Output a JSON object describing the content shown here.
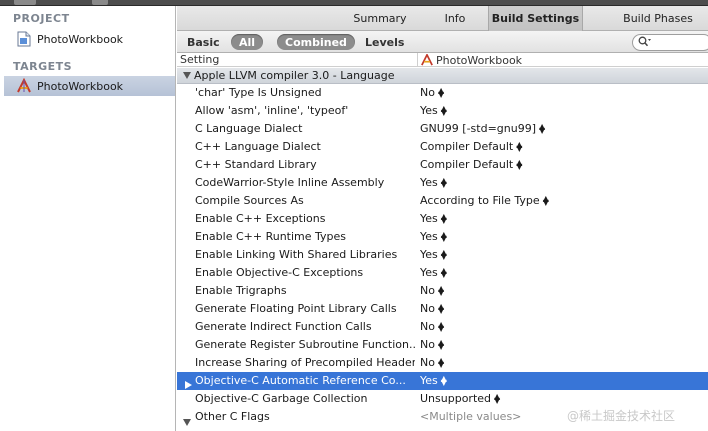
{
  "sidebar": {
    "project_header": "PROJECT",
    "project_item": "PhotoWorkbook",
    "targets_header": "TARGETS",
    "target_item": "PhotoWorkbook"
  },
  "tabs": [
    {
      "label": "Summary"
    },
    {
      "label": "Info"
    },
    {
      "label": "Build Settings"
    },
    {
      "label": "Build Phases"
    }
  ],
  "filter": {
    "basic": "Basic",
    "all": "All",
    "combined": "Combined",
    "levels": "Levels",
    "search_placeholder": ""
  },
  "columns": {
    "setting": "Setting",
    "target": "PhotoWorkbook"
  },
  "section": {
    "title": "Apple LLVM compiler 3.0 - Language"
  },
  "rows": [
    {
      "name": "'char' Type Is Unsigned",
      "value": "No"
    },
    {
      "name": "Allow 'asm', 'inline', 'typeof'",
      "value": "Yes"
    },
    {
      "name": "C Language Dialect",
      "value": "GNU99 [-std=gnu99]"
    },
    {
      "name": "C++ Language Dialect",
      "value": "Compiler Default"
    },
    {
      "name": "C++ Standard Library",
      "value": "Compiler Default"
    },
    {
      "name": "CodeWarrior-Style Inline Assembly",
      "value": "Yes"
    },
    {
      "name": "Compile Sources As",
      "value": "According to File Type"
    },
    {
      "name": "Enable C++ Exceptions",
      "value": "Yes"
    },
    {
      "name": "Enable C++ Runtime Types",
      "value": "Yes"
    },
    {
      "name": "Enable Linking With Shared Libraries",
      "value": "Yes"
    },
    {
      "name": "Enable Objective-C Exceptions",
      "value": "Yes"
    },
    {
      "name": "Enable Trigraphs",
      "value": "No"
    },
    {
      "name": "Generate Floating Point Library Calls",
      "value": "No"
    },
    {
      "name": "Generate Indirect Function Calls",
      "value": "No"
    },
    {
      "name": "Generate Register Subroutine Function...",
      "value": "No"
    },
    {
      "name": "Increase Sharing of Precompiled Headers",
      "value": "No"
    },
    {
      "name": "Objective-C Automatic Reference Co...",
      "value": "Yes"
    },
    {
      "name": "Objective-C Garbage Collection",
      "value": "Unsupported"
    },
    {
      "name": "Other C Flags",
      "value": "<Multiple values>"
    }
  ],
  "watermark": "@稀土掘金技术社区",
  "colors": {
    "selection": "#3875d7",
    "sidebar_selection": "#b6c2d6",
    "section_header": "#d6dbe1"
  }
}
